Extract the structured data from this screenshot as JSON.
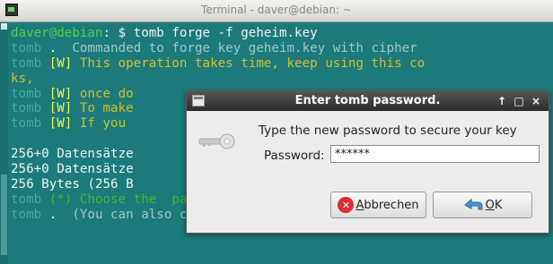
{
  "window": {
    "title": "Terminal - daver@debian: ~"
  },
  "terminal": {
    "lines": [
      [
        {
          "t": "daver@debian",
          "c": "c-user"
        },
        {
          "t": ": $ tomb forge -f geheim.key",
          "c": "c-white"
        }
      ],
      [
        {
          "t": "tomb",
          "c": "c-tomb"
        },
        {
          "t": " . ",
          "c": "c-white"
        },
        {
          "t": " Commanded to forge key geheim.key with cipher",
          "c": "c-dim"
        }
      ],
      [
        {
          "t": "tomb",
          "c": "c-tomb"
        },
        {
          "t": " [W] ",
          "c": "c-w"
        },
        {
          "t": "This operation takes time, keep using this co",
          "c": "c-warn"
        }
      ],
      [
        {
          "t": "ks,",
          "c": "c-warn"
        }
      ],
      [
        {
          "t": "tomb",
          "c": "c-tomb"
        },
        {
          "t": " [W] ",
          "c": "c-w"
        },
        {
          "t": "once do",
          "c": "c-warn"
        }
      ],
      [
        {
          "t": "tomb",
          "c": "c-tomb"
        },
        {
          "t": " [W] ",
          "c": "c-w"
        },
        {
          "t": "To make",
          "c": "c-warn"
        }
      ],
      [
        {
          "t": "tomb",
          "c": "c-tomb"
        },
        {
          "t": " [W] ",
          "c": "c-w"
        },
        {
          "t": "If you",
          "c": "c-warn"
        }
      ],
      [
        {
          "t": "",
          "c": "c-white"
        }
      ],
      [
        {
          "t": "256+0 Datensätze",
          "c": "c-white"
        }
      ],
      [
        {
          "t": "256+0 Datensätze",
          "c": "c-white"
        }
      ],
      [
        {
          "t": "256 Bytes (256 B",
          "c": "c-white"
        }
      ],
      [
        {
          "t": "tomb",
          "c": "c-tomb"
        },
        {
          "t": " (*) ",
          "c": "c-green"
        },
        {
          "t": "Choose the  password of your key: geheim.key",
          "c": "c-green"
        }
      ],
      [
        {
          "t": "tomb",
          "c": "c-tomb"
        },
        {
          "t": " . ",
          "c": "c-white"
        },
        {
          "t": " (You can also change it later using 'tomb pas",
          "c": "c-dim"
        }
      ]
    ]
  },
  "dialog": {
    "title": "Enter tomb password.",
    "controls": {
      "up": "↑",
      "maximize": "□",
      "close": "×"
    },
    "prompt": "Type the new password to secure your key",
    "password_label": "Password:",
    "password_value": "******",
    "cancel": {
      "underline": "A",
      "rest": "bbrechen"
    },
    "ok": {
      "underline": "O",
      "rest": "K"
    }
  },
  "colors": {
    "terminal_bg": "#1d7a7a",
    "user": "#4fd14f",
    "warning": "#f0f050",
    "dialog_titlebar": "#2c2c2c"
  },
  "icons": {
    "app": "terminal-icon",
    "dialog": "window-icon",
    "key": "key-icon",
    "cancel": "cancel-icon",
    "ok": "ok-icon"
  }
}
